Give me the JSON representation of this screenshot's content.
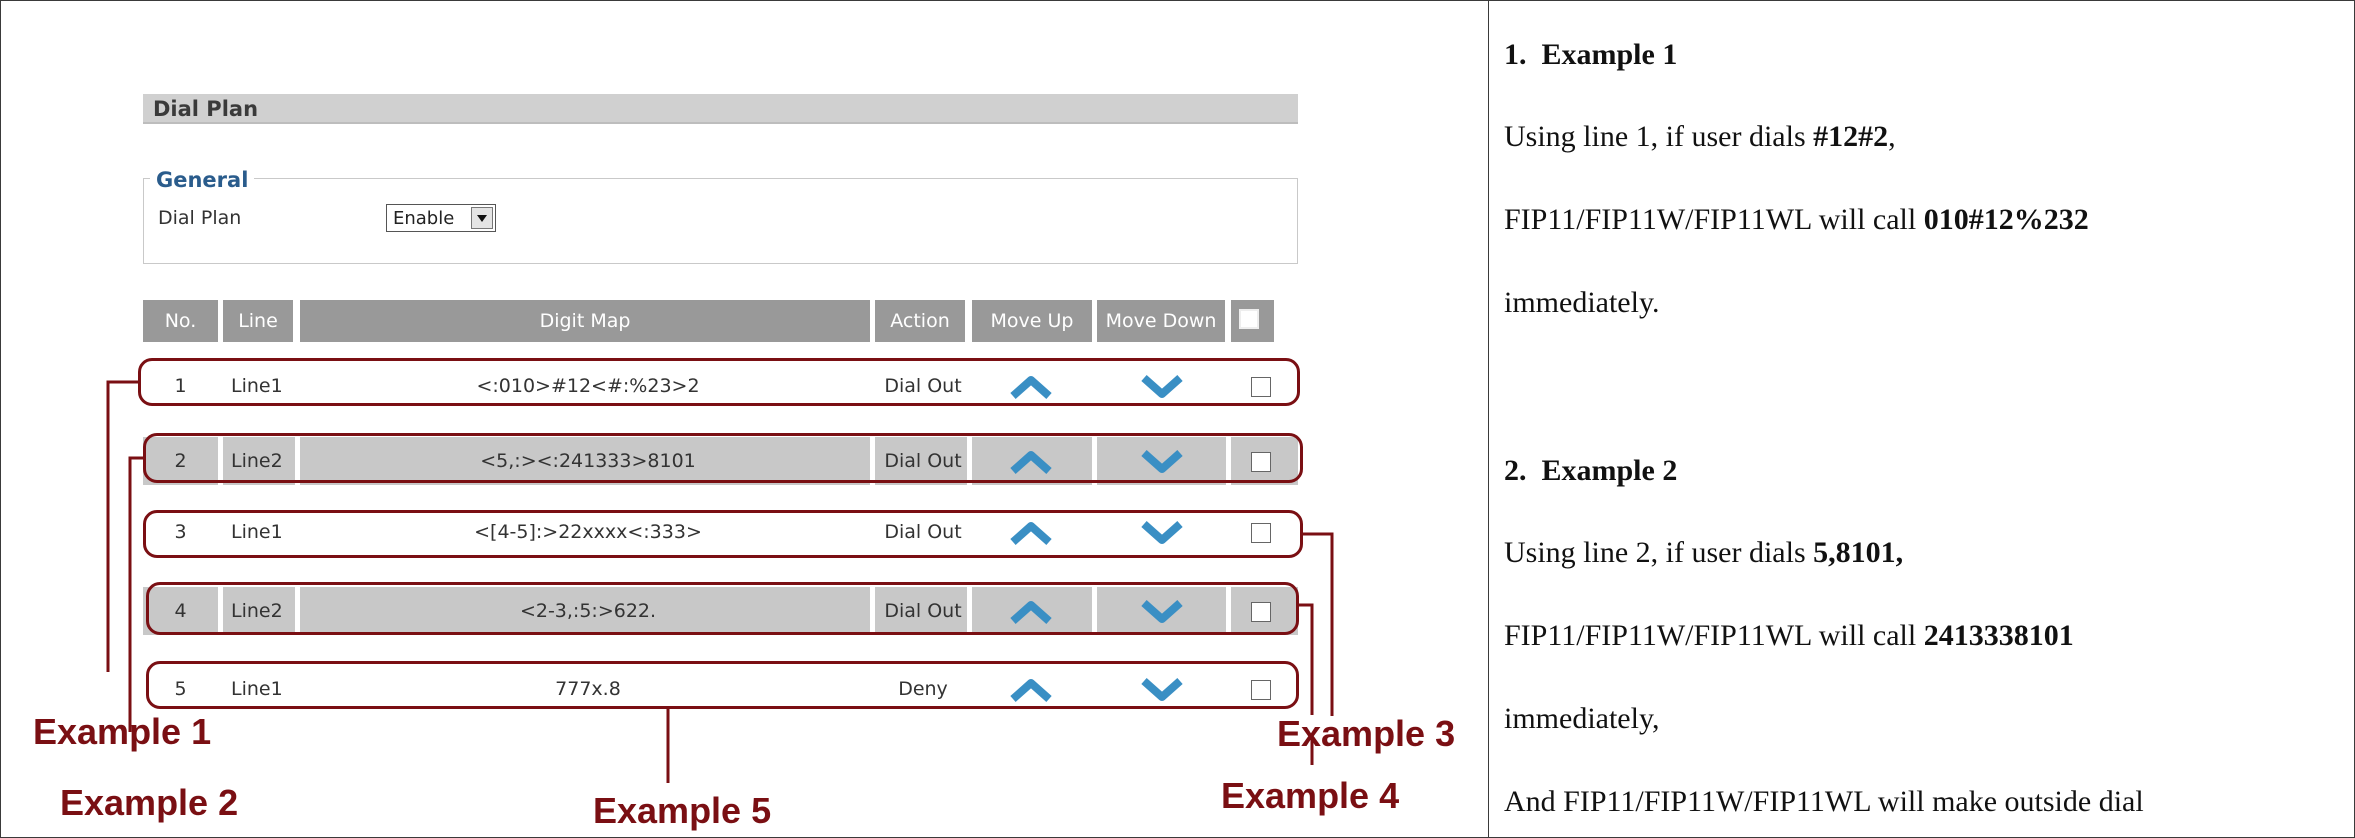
{
  "panel": {
    "title": "Dial Plan",
    "general_legend": "General",
    "dial_plan_label": "Dial Plan",
    "dial_plan_value": "Enable"
  },
  "table": {
    "headers": [
      "No.",
      "Line",
      "Digit Map",
      "Action",
      "Move Up",
      "Move Down"
    ],
    "rows": [
      {
        "no": "1",
        "line": "Line1",
        "digit_map": "<:010>#12<#:%23>2",
        "action": "Dial Out"
      },
      {
        "no": "2",
        "line": "Line2",
        "digit_map": "<5,:><:241333>8101",
        "action": "Dial Out"
      },
      {
        "no": "3",
        "line": "Line1",
        "digit_map": "<[4-5]:>22xxxx<:333>",
        "action": "Dial Out"
      },
      {
        "no": "4",
        "line": "Line2",
        "digit_map": "<2-3,:5:>622.",
        "action": "Dial Out"
      },
      {
        "no": "5",
        "line": "Line1",
        "digit_map": "777x.8",
        "action": "Deny"
      }
    ]
  },
  "callouts": {
    "ex1": "Example 1",
    "ex2": "Example 2",
    "ex3": "Example 3",
    "ex4": "Example 4",
    "ex5": "Example 5"
  },
  "text": {
    "ex1_heading_num": "1.",
    "ex1_heading": "Example 1",
    "ex1_line1_pre": "Using line 1, if user dials ",
    "ex1_line1_bold": "#12#2",
    "ex1_line1_post": ",",
    "ex1_line2_pre": "FIP11/FIP11W/FIP11WL will call ",
    "ex1_line2_bold": "010#12%232",
    "ex1_line3": "immediately.",
    "ex2_heading_num": "2.",
    "ex2_heading": "Example 2",
    "ex2_line1_pre": "Using line 2, if user dials ",
    "ex2_line1_bold": "5,8101,",
    "ex2_line2_pre": "FIP11/FIP11W/FIP11WL will call ",
    "ex2_line2_bold": "2413338101",
    "ex2_line3": "immediately,",
    "ex2_line4": "And FIP11/FIP11W/FIP11WL will make outside dial"
  },
  "colors": {
    "callout": "#7a0f13",
    "arrow": "#3a8fc4",
    "header": "#999999",
    "row_grey": "#c8c8c8"
  }
}
